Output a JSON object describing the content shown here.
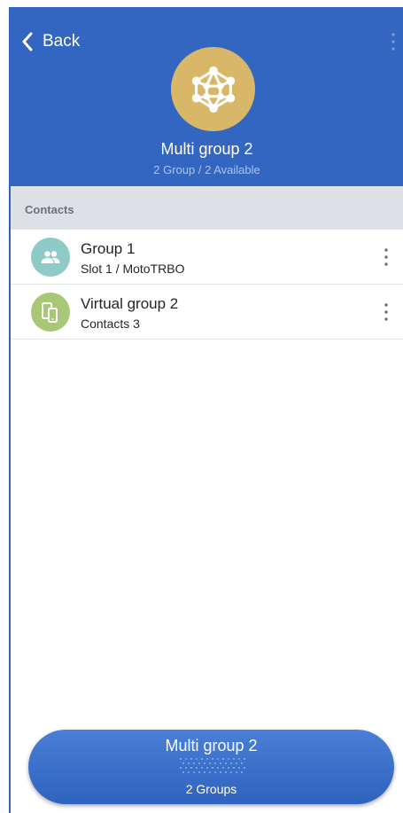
{
  "header": {
    "back_label": "Back",
    "title": "Multi group 2",
    "subtitle": "2 Group / 2 Available",
    "avatar_icon": "network-icon",
    "avatar_color": "#d8b868",
    "background_color": "#3266c1"
  },
  "section": {
    "label": "Contacts"
  },
  "contacts": [
    {
      "name": "Group 1",
      "detail": "Slot 1 / MotoTRBO",
      "icon": "people-icon",
      "icon_color": "#8ecbc6"
    },
    {
      "name": "Virtual group 2",
      "detail": "Contacts 3",
      "icon": "devices-icon",
      "icon_color": "#a8c878"
    }
  ],
  "ptt": {
    "title": "Multi group 2",
    "subtitle": "2 Groups"
  }
}
